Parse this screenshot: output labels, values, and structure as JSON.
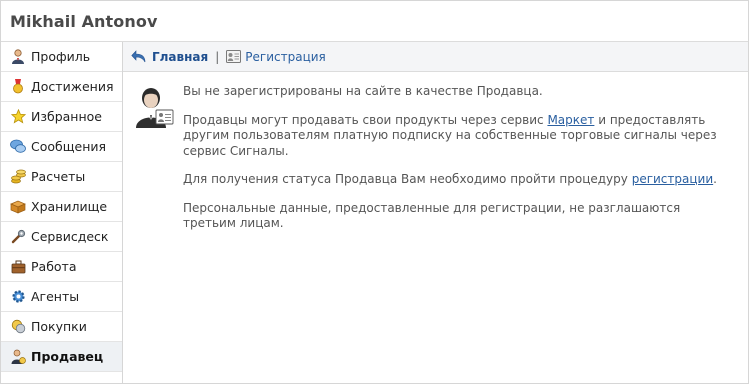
{
  "header": {
    "user_name": "Mikhail Antonov"
  },
  "sidebar": {
    "items": [
      {
        "label": "Профиль",
        "icon": "user-icon"
      },
      {
        "label": "Достижения",
        "icon": "medal-icon"
      },
      {
        "label": "Избранное",
        "icon": "star-icon"
      },
      {
        "label": "Сообщения",
        "icon": "chat-icon"
      },
      {
        "label": "Расчеты",
        "icon": "coins-icon"
      },
      {
        "label": "Хранилище",
        "icon": "box-icon"
      },
      {
        "label": "Сервисдеск",
        "icon": "tools-icon"
      },
      {
        "label": "Работа",
        "icon": "briefcase-icon"
      },
      {
        "label": "Агенты",
        "icon": "gear-icon"
      },
      {
        "label": "Покупки",
        "icon": "purchases-icon"
      },
      {
        "label": "Продавец",
        "icon": "seller-icon",
        "active": true
      }
    ]
  },
  "breadcrumb": {
    "home": "Главная",
    "separator": "|",
    "current": "Регистрация"
  },
  "content": {
    "p1": "Вы не зарегистрированы на сайте в качестве Продавца.",
    "p2_before": "Продавцы могут продавать свои продукты через сервис ",
    "p2_link": "Маркет",
    "p2_after": " и предоставлять другим пользователям платную подписку на собственные торговые сигналы через сервис Сигналы.",
    "p3_before": "Для получения статуса Продавца Вам необходимо пройти процедуру ",
    "p3_link": "регистрации",
    "p3_after": ".",
    "p4": "Персональные данные, предоставленные для регистрации, не разглашаются третьим лицам."
  },
  "colors": {
    "link": "#2a5fa0",
    "active_bg": "#eef1f4",
    "border": "#d6d6d6"
  }
}
